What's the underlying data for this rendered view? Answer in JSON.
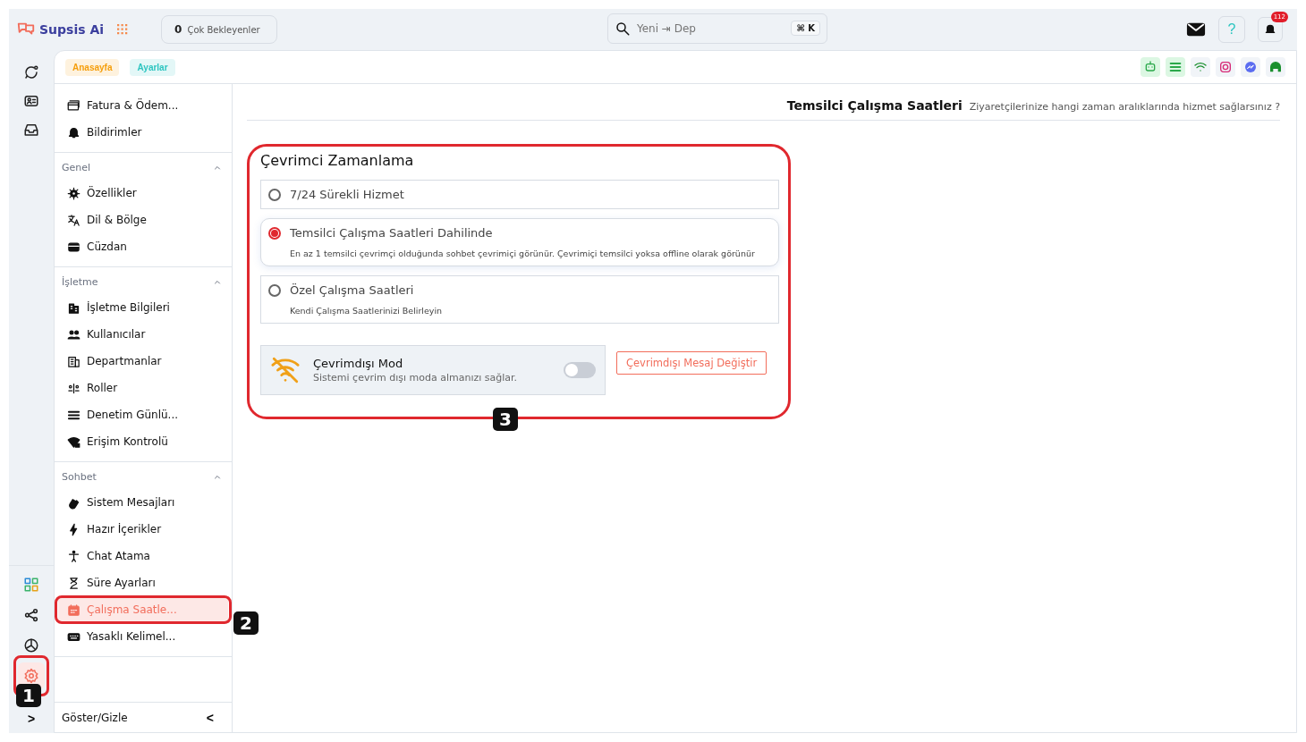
{
  "topbar": {
    "brand": "Supsis Ai",
    "pending": {
      "count": "0",
      "label": "Çok Bekleyenler"
    },
    "search": {
      "placeholder": "Yeni ⇥ Dep",
      "shortcut": "⌘ K"
    },
    "help": "?",
    "notifications": "112"
  },
  "rail": {
    "top": [
      {
        "selected": false
      },
      {
        "selected": false
      },
      {
        "selected": false
      }
    ],
    "bottom": [
      {
        "selected": false
      },
      {
        "selected": false
      },
      {
        "selected": false
      },
      {
        "selected": true
      }
    ],
    "expand": ">"
  },
  "breadcrumbs": [
    {
      "label": "Anasayfa",
      "color": "#f59e0b"
    },
    {
      "label": "Ayarlar",
      "color": "#2cc5c0"
    }
  ],
  "settings_menu": {
    "groups": [
      {
        "items": [
          {
            "label": "Fatura & Ödem...",
            "selected": false
          },
          {
            "label": "Bildirimler",
            "selected": false
          }
        ]
      },
      {
        "title": "Genel",
        "expanded": true,
        "items": [
          {
            "label": "Özellikler",
            "selected": false
          },
          {
            "label": "Dil & Bölge",
            "selected": false
          },
          {
            "label": "Cüzdan",
            "selected": false
          }
        ]
      },
      {
        "title": "İşletme",
        "expanded": true,
        "items": [
          {
            "label": "İşletme Bilgileri",
            "selected": false
          },
          {
            "label": "Kullanıcılar",
            "selected": false
          },
          {
            "label": "Departmanlar",
            "selected": false
          },
          {
            "label": "Roller",
            "selected": false
          },
          {
            "label": "Denetim Günlü...",
            "selected": false
          },
          {
            "label": "Erişim Kontrolü",
            "selected": false
          }
        ]
      },
      {
        "title": "Sohbet",
        "expanded": true,
        "items": [
          {
            "label": "Sistem Mesajları",
            "selected": false
          },
          {
            "label": "Hazır İçerikler",
            "selected": false
          },
          {
            "label": "Chat Atama",
            "selected": false
          },
          {
            "label": "Süre Ayarları",
            "selected": false
          },
          {
            "label": "Çalışma Saatle...",
            "selected": true
          },
          {
            "label": "Yasaklı Kelimel...",
            "selected": false
          }
        ]
      }
    ],
    "footer": {
      "label": "Göster/Gizle",
      "collapse": "<"
    }
  },
  "page_header": {
    "title": "Temsilci Çalışma Saatleri",
    "subtitle": "Ziyaretçilerinize hangi zaman aralıklarında hizmet sağlarsınız ?"
  },
  "scheduling": {
    "title": "Çevrimci Zamanlama",
    "options": [
      {
        "label": "7/24 Sürekli Hizmet",
        "selected": false
      },
      {
        "label": "Temsilci Çalışma Saatleri Dahilinde",
        "description": "En az 1 temsilci çevrimçi olduğunda sohbet çevrimiçi görünür. Çevrimiçi temsilci yoksa offline olarak görünür",
        "selected": true
      },
      {
        "label": "Özel Çalışma Saatleri",
        "description": "Kendi Çalışma Saatlerinizi Belirleyin",
        "selected": false
      }
    ],
    "offline_mode": {
      "title": "Çevrimdışı Mod",
      "description": "Sistemi çevrim dışı moda almanızı sağlar.",
      "on": false
    },
    "offline_message_button": "Çevrimdışı Mesaj Değiştir"
  },
  "annotations": [
    {
      "label": "1"
    },
    {
      "label": "2"
    },
    {
      "label": "3"
    }
  ]
}
